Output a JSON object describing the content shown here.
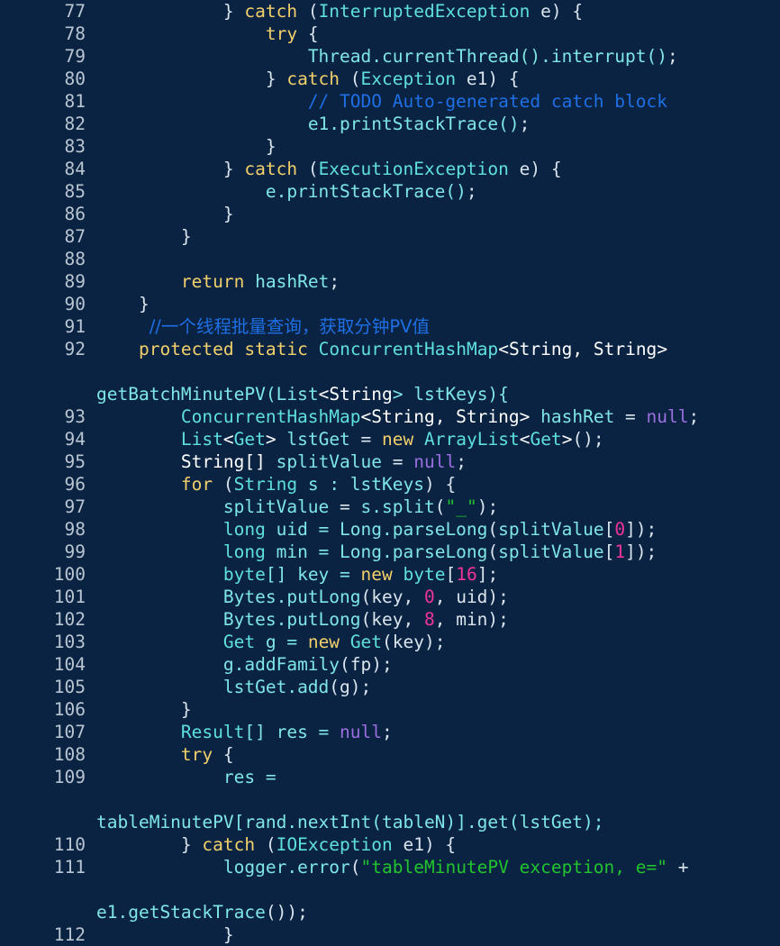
{
  "viewer": {
    "type": "code-viewer",
    "language": "Java",
    "background_color": "#0a2342",
    "default_text_color": "#e9eef3",
    "gutter_color": "#b9c6d2",
    "first_line": 77,
    "last_line": 112
  },
  "colors": {
    "keyword": "#f2d06b",
    "type": "#5fe0e0",
    "identifier": "#7fe6e6",
    "comment": "#1f6fe5",
    "string": "#22c32e",
    "number": "#f0339b",
    "null_literal": "#9b6fe0",
    "punctuation": "#d9e4ec",
    "plain": "#ffffff"
  },
  "lines": [
    {
      "num": "77",
      "text": "            } catch (InterruptedException e) {"
    },
    {
      "num": "78",
      "text": "                try {"
    },
    {
      "num": "79",
      "text": "                    Thread.currentThread().interrupt();"
    },
    {
      "num": "80",
      "text": "                } catch (Exception e1) {"
    },
    {
      "num": "81",
      "text": "                    // TODO Auto-generated catch block"
    },
    {
      "num": "82",
      "text": "                    e1.printStackTrace();"
    },
    {
      "num": "83",
      "text": "                }"
    },
    {
      "num": "84",
      "text": "            } catch (ExecutionException e) {"
    },
    {
      "num": "85",
      "text": "                e.printStackTrace();"
    },
    {
      "num": "86",
      "text": "            }"
    },
    {
      "num": "87",
      "text": "        }"
    },
    {
      "num": "88",
      "text": ""
    },
    {
      "num": "89",
      "text": "        return hashRet;"
    },
    {
      "num": "90",
      "text": "    }"
    },
    {
      "num": "91",
      "text": "     //一个线程批量查询，获取分钟PV值"
    },
    {
      "num": "92",
      "text": "    protected static ConcurrentHashMap<String, String> getBatchMinutePV(List<String> lstKeys){"
    },
    {
      "num": "93",
      "text": "        ConcurrentHashMap<String, String> hashRet = null;"
    },
    {
      "num": "94",
      "text": "        List<Get> lstGet = new ArrayList<Get>();"
    },
    {
      "num": "95",
      "text": "        String[] splitValue = null;"
    },
    {
      "num": "96",
      "text": "        for (String s : lstKeys) {"
    },
    {
      "num": "97",
      "text": "            splitValue = s.split(\"_\");"
    },
    {
      "num": "98",
      "text": "            long uid = Long.parseLong(splitValue[0]);"
    },
    {
      "num": "99",
      "text": "            long min = Long.parseLong(splitValue[1]);"
    },
    {
      "num": "100",
      "text": "            byte[] key = new byte[16];"
    },
    {
      "num": "101",
      "text": "            Bytes.putLong(key, 0, uid);"
    },
    {
      "num": "102",
      "text": "            Bytes.putLong(key, 8, min);"
    },
    {
      "num": "103",
      "text": "            Get g = new Get(key);"
    },
    {
      "num": "104",
      "text": "            g.addFamily(fp);"
    },
    {
      "num": "105",
      "text": "            lstGet.add(g);"
    },
    {
      "num": "106",
      "text": "        }"
    },
    {
      "num": "107",
      "text": "        Result[] res = null;"
    },
    {
      "num": "108",
      "text": "        try {"
    },
    {
      "num": "109",
      "text": "            res = tableMinutePV[rand.nextInt(tableN)].get(lstGet);"
    },
    {
      "num": "110",
      "text": "        } catch (IOException e1) {"
    },
    {
      "num": "111",
      "text": "            logger.error(\"tableMinutePV exception, e=\" + e1.getStackTrace());"
    },
    {
      "num": "112",
      "text": "            }"
    }
  ],
  "rendered": [
    {
      "num": "77",
      "segments": [
        {
          "t": "            } ",
          "c": "punct"
        },
        {
          "t": "catch",
          "c": "keyword"
        },
        {
          "t": " (",
          "c": "punct"
        },
        {
          "t": "InterruptedException",
          "c": "type"
        },
        {
          "t": " e) {",
          "c": "punct"
        }
      ]
    },
    {
      "num": "78",
      "segments": [
        {
          "t": "                ",
          "c": "punct"
        },
        {
          "t": "try",
          "c": "keyword"
        },
        {
          "t": " {",
          "c": "punct"
        }
      ]
    },
    {
      "num": "79",
      "segments": [
        {
          "t": "                    ",
          "c": "punct"
        },
        {
          "t": "Thread.currentThread().interrupt()",
          "c": "ident"
        },
        {
          "t": ";",
          "c": "punct"
        }
      ]
    },
    {
      "num": "80",
      "segments": [
        {
          "t": "                } ",
          "c": "punct"
        },
        {
          "t": "catch",
          "c": "keyword"
        },
        {
          "t": " (",
          "c": "punct"
        },
        {
          "t": "Exception",
          "c": "type"
        },
        {
          "t": " e1) {",
          "c": "punct"
        }
      ]
    },
    {
      "num": "81",
      "segments": [
        {
          "t": "                    ",
          "c": "punct"
        },
        {
          "t": "// TODO Auto-generated catch block",
          "c": "comment"
        }
      ]
    },
    {
      "num": "82",
      "segments": [
        {
          "t": "                    ",
          "c": "punct"
        },
        {
          "t": "e1.printStackTrace()",
          "c": "ident"
        },
        {
          "t": ";",
          "c": "punct"
        }
      ]
    },
    {
      "num": "83",
      "segments": [
        {
          "t": "                }",
          "c": "punct"
        }
      ]
    },
    {
      "num": "84",
      "segments": [
        {
          "t": "            } ",
          "c": "punct"
        },
        {
          "t": "catch",
          "c": "keyword"
        },
        {
          "t": " (",
          "c": "punct"
        },
        {
          "t": "ExecutionException",
          "c": "type"
        },
        {
          "t": " e) {",
          "c": "punct"
        }
      ]
    },
    {
      "num": "85",
      "segments": [
        {
          "t": "                ",
          "c": "punct"
        },
        {
          "t": "e.printStackTrace()",
          "c": "ident"
        },
        {
          "t": ";",
          "c": "punct"
        }
      ]
    },
    {
      "num": "86",
      "segments": [
        {
          "t": "            }",
          "c": "punct"
        }
      ]
    },
    {
      "num": "87",
      "segments": [
        {
          "t": "        }",
          "c": "punct"
        }
      ]
    },
    {
      "num": "88",
      "segments": [
        {
          "t": "",
          "c": "punct"
        }
      ]
    },
    {
      "num": "89",
      "segments": [
        {
          "t": "        ",
          "c": "punct"
        },
        {
          "t": "return",
          "c": "keyword"
        },
        {
          "t": " ",
          "c": "punct"
        },
        {
          "t": "hashRet",
          "c": "ident"
        },
        {
          "t": ";",
          "c": "punct"
        }
      ]
    },
    {
      "num": "90",
      "segments": [
        {
          "t": "    }",
          "c": "punct"
        }
      ]
    },
    {
      "num": "91",
      "segments": [
        {
          "t": "     ",
          "c": "punct"
        },
        {
          "t": "//一个线程批量查询，获取分钟PV值",
          "c": "comment cjk"
        }
      ]
    },
    {
      "num": "92",
      "segments": [
        {
          "t": "    ",
          "c": "punct"
        },
        {
          "t": "protected",
          "c": "keyword"
        },
        {
          "t": " ",
          "c": "punct"
        },
        {
          "t": "static",
          "c": "keyword"
        },
        {
          "t": " ",
          "c": "punct"
        },
        {
          "t": "ConcurrentHashMap",
          "c": "type"
        },
        {
          "t": "<",
          "c": "plain"
        },
        {
          "t": "String, String",
          "c": "plain"
        },
        {
          "t": ">",
          "c": "plain"
        },
        {
          "t": "\n  ",
          "c": "punct"
        },
        {
          "t": "getBatchMinutePV",
          "c": "ident"
        },
        {
          "t": "(",
          "c": "ident"
        },
        {
          "t": "List",
          "c": "ident"
        },
        {
          "t": "<",
          "c": "plain"
        },
        {
          "t": "String",
          "c": "plain"
        },
        {
          "t": ">",
          "c": "ident"
        },
        {
          "t": " lstKeys){",
          "c": "ident"
        }
      ]
    },
    {
      "num": "93",
      "segments": [
        {
          "t": "        ",
          "c": "punct"
        },
        {
          "t": "ConcurrentHashMap",
          "c": "type"
        },
        {
          "t": "<",
          "c": "plain"
        },
        {
          "t": "String, String",
          "c": "plain"
        },
        {
          "t": "> ",
          "c": "plain"
        },
        {
          "t": "hashRet",
          "c": "ident"
        },
        {
          "t": " = ",
          "c": "punct"
        },
        {
          "t": "null",
          "c": "null"
        },
        {
          "t": ";",
          "c": "punct"
        }
      ]
    },
    {
      "num": "94",
      "segments": [
        {
          "t": "        ",
          "c": "punct"
        },
        {
          "t": "List",
          "c": "type"
        },
        {
          "t": "<",
          "c": "plain"
        },
        {
          "t": "Get",
          "c": "type"
        },
        {
          "t": "> ",
          "c": "plain"
        },
        {
          "t": "lstGet",
          "c": "ident"
        },
        {
          "t": " = ",
          "c": "punct"
        },
        {
          "t": "new",
          "c": "keyword"
        },
        {
          "t": " ",
          "c": "punct"
        },
        {
          "t": "ArrayList",
          "c": "type"
        },
        {
          "t": "<",
          "c": "plain"
        },
        {
          "t": "Get",
          "c": "type"
        },
        {
          "t": ">",
          "c": "plain"
        },
        {
          "t": "();",
          "c": "punct"
        }
      ]
    },
    {
      "num": "95",
      "segments": [
        {
          "t": "        ",
          "c": "punct"
        },
        {
          "t": "String",
          "c": "plain"
        },
        {
          "t": "[] ",
          "c": "plain"
        },
        {
          "t": "splitValue",
          "c": "ident"
        },
        {
          "t": " = ",
          "c": "punct"
        },
        {
          "t": "null",
          "c": "null"
        },
        {
          "t": ";",
          "c": "punct"
        }
      ]
    },
    {
      "num": "96",
      "segments": [
        {
          "t": "        ",
          "c": "punct"
        },
        {
          "t": "for",
          "c": "keyword"
        },
        {
          "t": " (",
          "c": "punct"
        },
        {
          "t": "String",
          "c": "type"
        },
        {
          "t": " s : ",
          "c": "ident"
        },
        {
          "t": "lstKeys",
          "c": "ident"
        },
        {
          "t": ") {",
          "c": "punct"
        }
      ]
    },
    {
      "num": "97",
      "segments": [
        {
          "t": "            ",
          "c": "punct"
        },
        {
          "t": "splitValue",
          "c": "ident"
        },
        {
          "t": " = ",
          "c": "punct"
        },
        {
          "t": "s.split",
          "c": "ident"
        },
        {
          "t": "(",
          "c": "punct"
        },
        {
          "t": "\"_\"",
          "c": "string"
        },
        {
          "t": ");",
          "c": "punct"
        }
      ]
    },
    {
      "num": "98",
      "segments": [
        {
          "t": "            ",
          "c": "punct"
        },
        {
          "t": "long",
          "c": "type"
        },
        {
          "t": " uid = ",
          "c": "ident"
        },
        {
          "t": "Long.parseLong",
          "c": "ident"
        },
        {
          "t": "(",
          "c": "punct"
        },
        {
          "t": "splitValue",
          "c": "ident"
        },
        {
          "t": "[",
          "c": "punct"
        },
        {
          "t": "0",
          "c": "number"
        },
        {
          "t": "]);",
          "c": "punct"
        }
      ]
    },
    {
      "num": "99",
      "segments": [
        {
          "t": "            ",
          "c": "punct"
        },
        {
          "t": "long",
          "c": "type"
        },
        {
          "t": " min = ",
          "c": "ident"
        },
        {
          "t": "Long.parseLong",
          "c": "ident"
        },
        {
          "t": "(",
          "c": "punct"
        },
        {
          "t": "splitValue",
          "c": "ident"
        },
        {
          "t": "[",
          "c": "punct"
        },
        {
          "t": "1",
          "c": "number"
        },
        {
          "t": "]);",
          "c": "punct"
        }
      ]
    },
    {
      "num": "100",
      "segments": [
        {
          "t": "            ",
          "c": "punct"
        },
        {
          "t": "byte",
          "c": "type"
        },
        {
          "t": "[] key = ",
          "c": "ident"
        },
        {
          "t": "new",
          "c": "keyword"
        },
        {
          "t": " ",
          "c": "punct"
        },
        {
          "t": "byte",
          "c": "type"
        },
        {
          "t": "[",
          "c": "punct"
        },
        {
          "t": "16",
          "c": "number"
        },
        {
          "t": "];",
          "c": "punct"
        }
      ]
    },
    {
      "num": "101",
      "segments": [
        {
          "t": "            ",
          "c": "punct"
        },
        {
          "t": "Bytes.putLong",
          "c": "ident"
        },
        {
          "t": "(key, ",
          "c": "punct"
        },
        {
          "t": "0",
          "c": "number"
        },
        {
          "t": ", uid);",
          "c": "punct"
        }
      ]
    },
    {
      "num": "102",
      "segments": [
        {
          "t": "            ",
          "c": "punct"
        },
        {
          "t": "Bytes.putLong",
          "c": "ident"
        },
        {
          "t": "(key, ",
          "c": "punct"
        },
        {
          "t": "8",
          "c": "number"
        },
        {
          "t": ", min);",
          "c": "punct"
        }
      ]
    },
    {
      "num": "103",
      "segments": [
        {
          "t": "            ",
          "c": "punct"
        },
        {
          "t": "Get",
          "c": "type"
        },
        {
          "t": " g = ",
          "c": "ident"
        },
        {
          "t": "new",
          "c": "keyword"
        },
        {
          "t": " ",
          "c": "punct"
        },
        {
          "t": "Get",
          "c": "type"
        },
        {
          "t": "(key);",
          "c": "punct"
        }
      ]
    },
    {
      "num": "104",
      "segments": [
        {
          "t": "            ",
          "c": "punct"
        },
        {
          "t": "g.addFamily",
          "c": "ident"
        },
        {
          "t": "(fp);",
          "c": "punct"
        }
      ]
    },
    {
      "num": "105",
      "segments": [
        {
          "t": "            ",
          "c": "punct"
        },
        {
          "t": "lstGet.add",
          "c": "ident"
        },
        {
          "t": "(g);",
          "c": "punct"
        }
      ]
    },
    {
      "num": "106",
      "segments": [
        {
          "t": "        }",
          "c": "punct"
        }
      ]
    },
    {
      "num": "107",
      "segments": [
        {
          "t": "        ",
          "c": "punct"
        },
        {
          "t": "Result",
          "c": "type"
        },
        {
          "t": "[] res = ",
          "c": "ident"
        },
        {
          "t": "null",
          "c": "null"
        },
        {
          "t": ";",
          "c": "punct"
        }
      ]
    },
    {
      "num": "108",
      "segments": [
        {
          "t": "        ",
          "c": "punct"
        },
        {
          "t": "try",
          "c": "keyword"
        },
        {
          "t": " {",
          "c": "punct"
        }
      ]
    },
    {
      "num": "109",
      "segments": [
        {
          "t": "            res = ",
          "c": "ident"
        },
        {
          "t": "\n  ",
          "c": "punct"
        },
        {
          "t": "tableMinutePV[rand.nextInt(tableN)].get(lstGet);",
          "c": "ident"
        }
      ]
    },
    {
      "num": "110",
      "segments": [
        {
          "t": "        } ",
          "c": "punct"
        },
        {
          "t": "catch",
          "c": "keyword"
        },
        {
          "t": " (",
          "c": "punct"
        },
        {
          "t": "IOException",
          "c": "type"
        },
        {
          "t": " e1) {",
          "c": "punct"
        }
      ]
    },
    {
      "num": "111",
      "segments": [
        {
          "t": "            ",
          "c": "punct"
        },
        {
          "t": "logger.error",
          "c": "ident"
        },
        {
          "t": "(",
          "c": "punct"
        },
        {
          "t": "\"tableMinutePV exception, e=\"",
          "c": "string"
        },
        {
          "t": " + ",
          "c": "punct"
        },
        {
          "t": "\n  ",
          "c": "punct"
        },
        {
          "t": "e1.getStackTrace",
          "c": "ident"
        },
        {
          "t": "());",
          "c": "punct"
        }
      ]
    },
    {
      "num": "112",
      "segments": [
        {
          "t": "            }",
          "c": "punct"
        }
      ]
    }
  ]
}
